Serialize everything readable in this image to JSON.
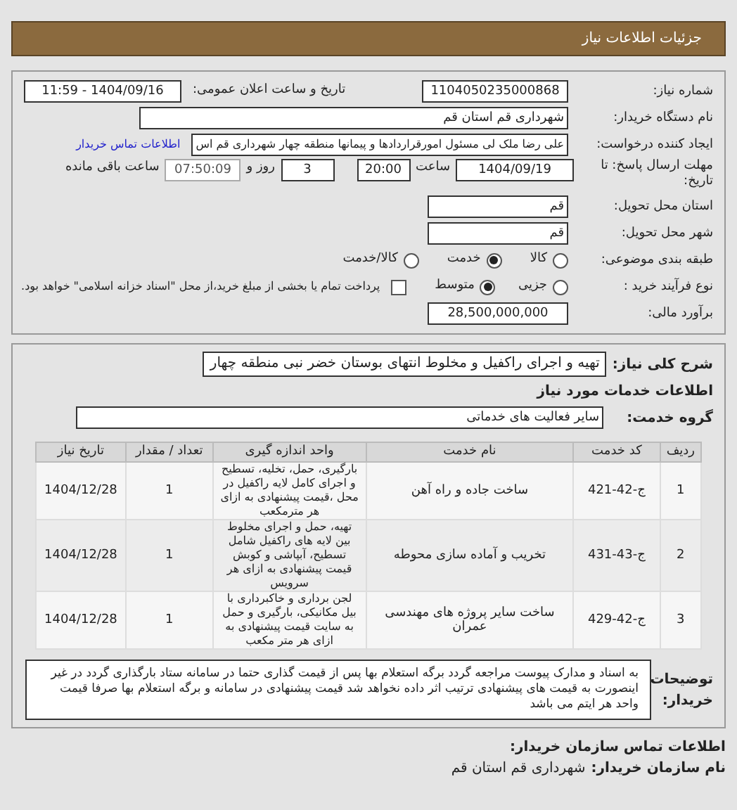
{
  "header": {
    "title": "جزئیات اطلاعات نیاز"
  },
  "need_number": {
    "label": "شماره نیاز:",
    "value": "1104050235000868"
  },
  "announce": {
    "label": "تاریخ و ساعت اعلان عمومی:",
    "value": "1404/09/16 - 11:59"
  },
  "buyer_org": {
    "label": "نام دستگاه خریدار:",
    "value": "شهرداری قم استان قم"
  },
  "requester": {
    "label": "ایجاد کننده درخواست:",
    "value": "علی رضا ملک لی مسئول امورقراردادها و پیمانها منطقه چهار  شهرداری قم اس",
    "link": "اطلاعات تماس خریدار"
  },
  "deadline": {
    "label": "مهلت ارسال پاسخ: تا تاریخ:",
    "date": "1404/09/19",
    "time_label": "ساعت",
    "time": "20:00",
    "days": "3",
    "days_label": "روز و",
    "remaining": "07:50:09",
    "remaining_label": "ساعت باقی مانده"
  },
  "province": {
    "label": "استان محل تحویل:",
    "value": "قم"
  },
  "city": {
    "label": "شهر محل تحویل:",
    "value": "قم"
  },
  "category": {
    "label": "طبقه بندی موضوعی:",
    "options": [
      {
        "label": "کالا",
        "selected": false
      },
      {
        "label": "خدمت",
        "selected": true
      },
      {
        "label": "کالا/خدمت",
        "selected": false
      }
    ]
  },
  "process": {
    "label": "نوع فرآیند خرید :",
    "options": [
      {
        "label": "جزیی",
        "selected": false
      },
      {
        "label": "متوسط",
        "selected": true
      }
    ],
    "payment": {
      "checked": false,
      "text": "پرداخت تمام یا بخشی از مبلغ خرید،از محل \"اسناد خزانه اسلامی\" خواهد بود."
    }
  },
  "budget": {
    "label": "برآورد مالی:",
    "value": "28,500,000,000"
  },
  "summary": {
    "label": "شرح کلی نیاز:",
    "value": "تهیه و اجرای راکفیل و مخلوط انتهای بوستان خضر نبی منطقه چهار"
  },
  "services_heading": "اطلاعات خدمات مورد نیاز",
  "service_group": {
    "label": "گروه خدمت:",
    "value": "سایر فعالیت های خدماتی"
  },
  "table": {
    "columns": [
      "ردیف",
      "کد خدمت",
      "نام خدمت",
      "واحد اندازه گیری",
      "تعداد / مقدار",
      "تاریخ نیاز"
    ],
    "rows": [
      {
        "cells": [
          "1",
          "ج-42-421",
          "ساخت جاده و راه آهن",
          "بارگیری، حمل، تخلیه، تسطیح و اجرای کامل لایه راکفیل در محل ،قیمت پیشنهادی به ازای هر مترمکعب",
          "1",
          "1404/12/28"
        ]
      },
      {
        "cells": [
          "2",
          "ج-43-431",
          "تخریب و آماده سازی محوطه",
          "تهیه، حمل و اجرای مخلوط بین لایه های راکفیل شامل تسطیح، آبپاشی و کوبش قیمت پیشنهادی به ازای هر سرویس",
          "1",
          "1404/12/28"
        ]
      },
      {
        "cells": [
          "3",
          "ج-42-429",
          "ساخت سایر پروژه های مهندسی عمران",
          "لجن برداری و خاکبرداری با بیل مکانیکی، بارگیری و حمل به سایت قیمت پیشنهادی به ازای هر متر مکعب",
          "1",
          "1404/12/28"
        ]
      }
    ]
  },
  "notes": {
    "label": "توضیحات خریدار:",
    "text": "به اسناد و مدارک پیوست مراجعه گردد برگه استعلام بها پس از قیمت گذاری حتما در سامانه ستاد بارگذاری گردد در غیر اینصورت به قیمت های پیشنهادی ترتیب اثر داده نخواهد شد قیمت پیشنهادی در سامانه و برگه استعلام بها صرفا قیمت واحد هر ایتم می باشد"
  },
  "contact": {
    "heading": "اطلاعات تماس سازمان خریدار:",
    "org_label": "نام سازمان خریدار:",
    "org_value": "شهرداری قم استان قم"
  }
}
